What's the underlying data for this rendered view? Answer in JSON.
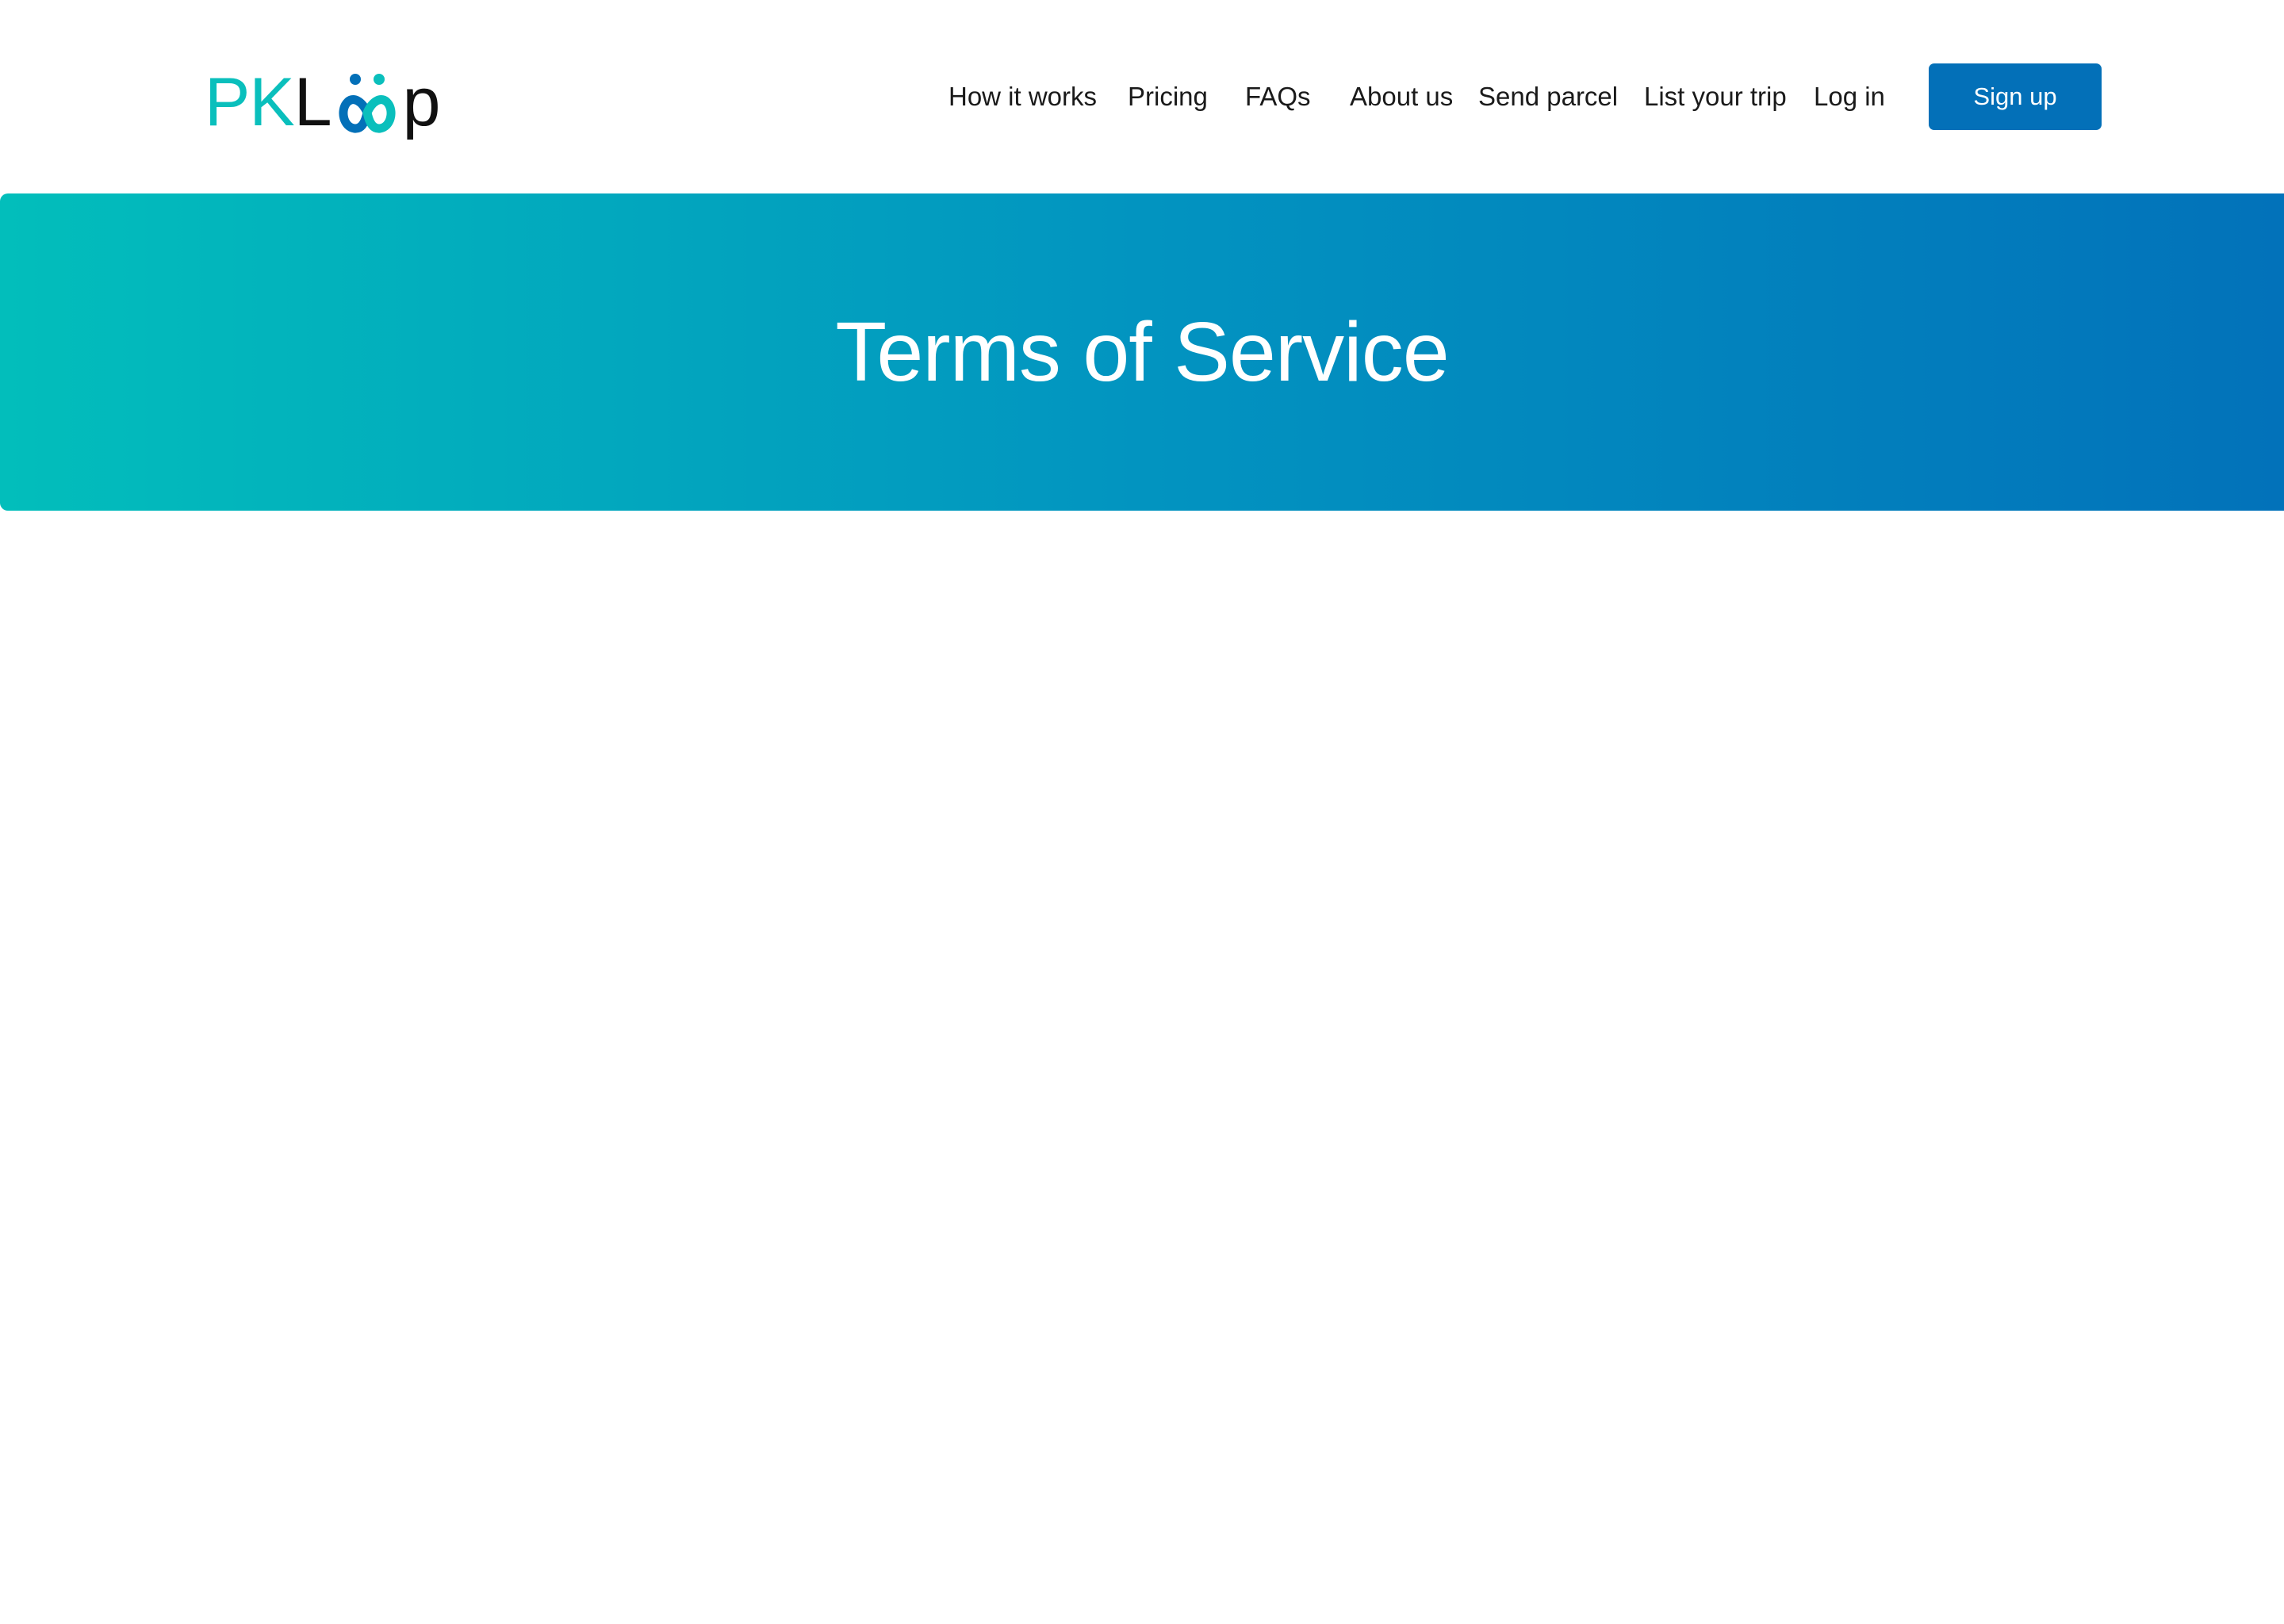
{
  "brand": {
    "logo_text_pk": "PK",
    "logo_text_l": "L",
    "logo_text_p": "p",
    "logo_full": "PKLoop",
    "colors": {
      "teal": "#0ABFBC",
      "blue": "#0370B8",
      "dark": "#111111"
    }
  },
  "nav": {
    "items": [
      {
        "label": "How it works"
      },
      {
        "label": "Pricing"
      },
      {
        "label": "FAQs"
      },
      {
        "label": "About us"
      },
      {
        "label": "Send parcel"
      },
      {
        "label": "List your trip"
      },
      {
        "label": "Log in"
      }
    ],
    "signup_label": "Sign up"
  },
  "hero": {
    "title": "Terms of Service",
    "gradient": [
      "#02BEBB",
      "#0272BA"
    ]
  }
}
